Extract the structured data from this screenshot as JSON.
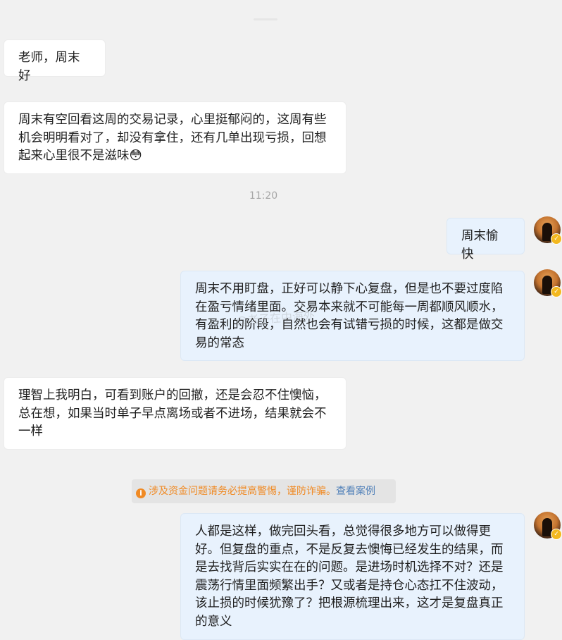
{
  "messages": [
    {
      "side": "left",
      "text": "老师，周末好"
    },
    {
      "side": "left",
      "text": "周末有空回看这周的交易记录，心里挺郁闷的，这周有些机会明明看对了，却没有拿住，还有几单出现亏损，回想起来心里很不是滋味😳"
    },
    {
      "side": "right",
      "text": "周末愉快"
    },
    {
      "side": "right",
      "text": "周末不用盯盘，正好可以静下心复盘，但是也不要过度陷在盈亏情绪里面。交易本来就不可能每一周都顺风顺水，有盈利的阶段，自然也会有试错亏损的时候，这都是做交易的常态"
    },
    {
      "side": "left",
      "text": "理智上我明白，可看到账户的回撤，还是会忍不住懊恼，总在想，如果当时单子早点离场或者不进场，结果就会不一样"
    },
    {
      "side": "right",
      "text": "人都是这样，做完回头看，总觉得很多地方可以做得更好。但复盘的重点，不是反复去懊悔已经发生的结果，而是去找背后实实在在的问题。是进场时机选择不对？还是震荡行情里面频繁出手？又或者是持仓心态扛不住波动，该止损的时候犹豫了？把根源梳理出来，这才是复盘真正的意义"
    }
  ],
  "timestamp": "11:20",
  "notice": {
    "text": "涉及资金问题请务必提高警惕，谨防诈骗。",
    "link": "查看案例"
  },
  "watermark": "@老子在中海外",
  "colors": {
    "background": "#f1f1f1",
    "left_bubble": "#ffffff",
    "right_bubble": "#e8f2fd",
    "notice_text": "#f08a24",
    "notice_link": "#4f7fb8",
    "badge": "#f3b81f"
  }
}
